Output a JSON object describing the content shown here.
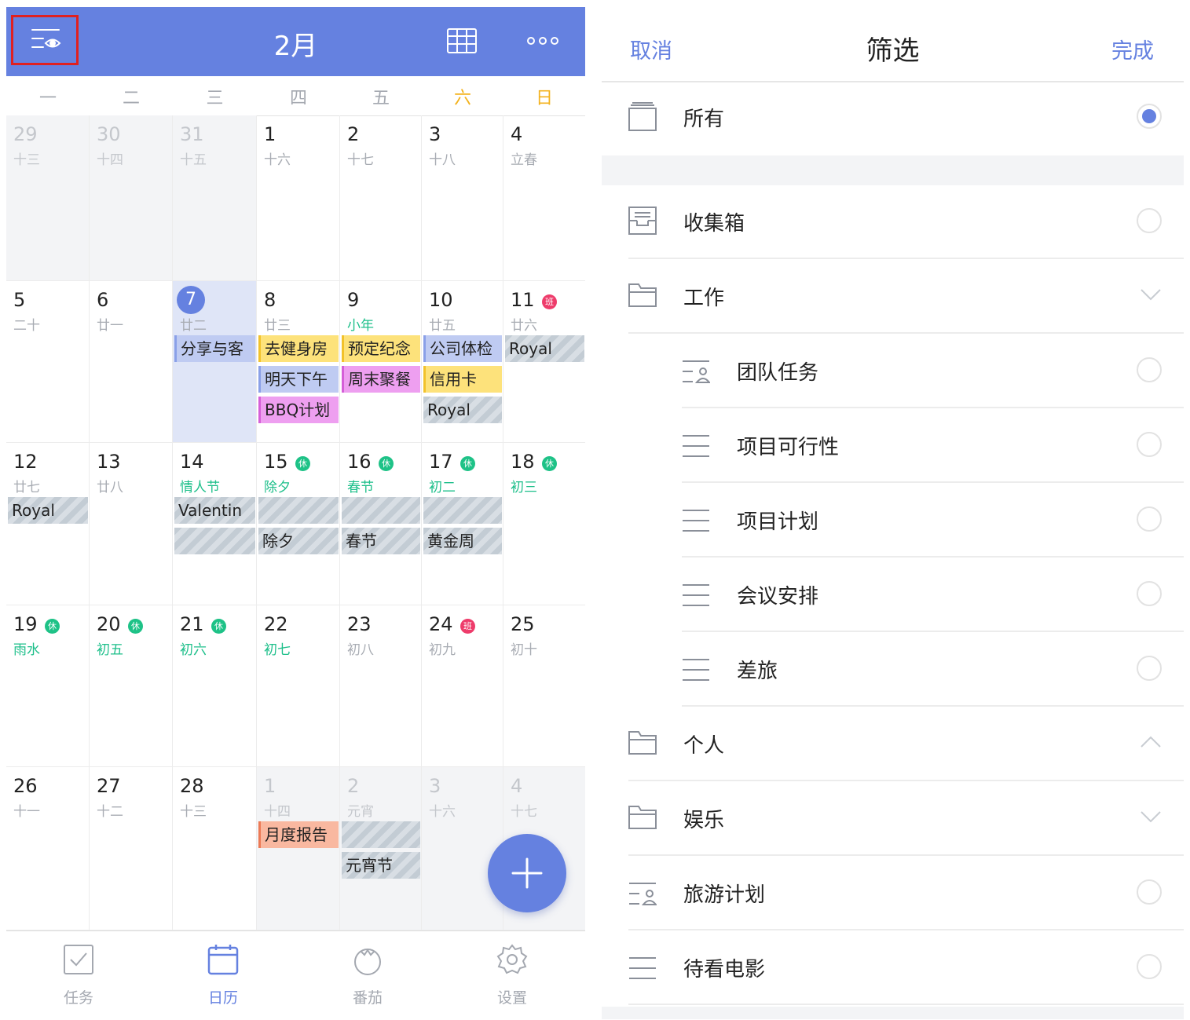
{
  "calendar": {
    "month_title": "2月",
    "weekdays": [
      {
        "label": "一",
        "weekend": false
      },
      {
        "label": "二",
        "weekend": false
      },
      {
        "label": "三",
        "weekend": false
      },
      {
        "label": "四",
        "weekend": false
      },
      {
        "label": "五",
        "weekend": false
      },
      {
        "label": "六",
        "weekend": true
      },
      {
        "label": "日",
        "weekend": true
      }
    ],
    "weeks": [
      [
        {
          "day": "29",
          "lunar": "十三",
          "out": true
        },
        {
          "day": "30",
          "lunar": "十四",
          "out": true
        },
        {
          "day": "31",
          "lunar": "十五",
          "out": true
        },
        {
          "day": "1",
          "lunar": "十六"
        },
        {
          "day": "2",
          "lunar": "十七"
        },
        {
          "day": "3",
          "lunar": "十八"
        },
        {
          "day": "4",
          "lunar": "立春"
        }
      ],
      [
        {
          "day": "5",
          "lunar": "二十"
        },
        {
          "day": "6",
          "lunar": "廿一"
        },
        {
          "day": "7",
          "lunar": "廿二",
          "today": true,
          "events": [
            {
              "label": "分享与客",
              "style": "blue"
            }
          ]
        },
        {
          "day": "8",
          "lunar": "廿三",
          "events": [
            {
              "label": "去健身房",
              "style": "yellow"
            },
            {
              "label": "明天下午",
              "style": "blue"
            },
            {
              "label": "BBQ计划",
              "style": "pink"
            }
          ]
        },
        {
          "day": "9",
          "lunar": "小年",
          "lunar_fest": true,
          "events": [
            {
              "label": "预定纪念",
              "style": "yellow"
            },
            {
              "label": "周末聚餐",
              "style": "pink"
            }
          ]
        },
        {
          "day": "10",
          "lunar": "廿五",
          "events": [
            {
              "label": "公司体检",
              "style": "blue"
            },
            {
              "label": "信用卡",
              "style": "yellow"
            },
            {
              "label": "Royal",
              "style": "hatch"
            }
          ]
        },
        {
          "day": "11",
          "lunar": "廿六",
          "badge": "班",
          "badge_type": "work",
          "events": [
            {
              "label": "Royal",
              "style": "hatch"
            }
          ]
        }
      ],
      [
        {
          "day": "12",
          "lunar": "廿七",
          "events": [
            {
              "label": "Royal",
              "style": "hatch"
            }
          ]
        },
        {
          "day": "13",
          "lunar": "廿八"
        },
        {
          "day": "14",
          "lunar": "情人节",
          "lunar_fest": true,
          "events": [
            {
              "label": "Valentin",
              "style": "hatch"
            },
            {
              "label": "",
              "style": "hatch"
            }
          ]
        },
        {
          "day": "15",
          "lunar": "除夕",
          "lunar_fest": true,
          "badge": "休",
          "badge_type": "rest",
          "events": [
            {
              "label": "",
              "style": "hatch"
            },
            {
              "label": "除夕",
              "style": "hatch"
            }
          ]
        },
        {
          "day": "16",
          "lunar": "春节",
          "lunar_fest": true,
          "badge": "休",
          "badge_type": "rest",
          "events": [
            {
              "label": "",
              "style": "hatch"
            },
            {
              "label": "春节",
              "style": "hatch"
            }
          ]
        },
        {
          "day": "17",
          "lunar": "初二",
          "lunar_fest": true,
          "badge": "休",
          "badge_type": "rest",
          "events": [
            {
              "label": "",
              "style": "hatch"
            },
            {
              "label": "黄金周",
              "style": "hatch"
            }
          ]
        },
        {
          "day": "18",
          "lunar": "初三",
          "lunar_fest": true,
          "badge": "休",
          "badge_type": "rest"
        }
      ],
      [
        {
          "day": "19",
          "lunar": "雨水",
          "lunar_fest": true,
          "badge": "休",
          "badge_type": "rest"
        },
        {
          "day": "20",
          "lunar": "初五",
          "lunar_fest": true,
          "badge": "休",
          "badge_type": "rest"
        },
        {
          "day": "21",
          "lunar": "初六",
          "lunar_fest": true,
          "badge": "休",
          "badge_type": "rest"
        },
        {
          "day": "22",
          "lunar": "初七",
          "lunar_fest": true
        },
        {
          "day": "23",
          "lunar": "初八"
        },
        {
          "day": "24",
          "lunar": "初九",
          "badge": "班",
          "badge_type": "work"
        },
        {
          "day": "25",
          "lunar": "初十"
        }
      ],
      [
        {
          "day": "26",
          "lunar": "十一"
        },
        {
          "day": "27",
          "lunar": "十二"
        },
        {
          "day": "28",
          "lunar": "十三"
        },
        {
          "day": "1",
          "lunar": "十四",
          "out": true,
          "events": [
            {
              "label": "月度报告",
              "style": "salmon"
            }
          ]
        },
        {
          "day": "2",
          "lunar": "元宵",
          "lunar_fest": true,
          "out": true,
          "events": [
            {
              "label": "",
              "style": "hatch"
            },
            {
              "label": "元宵节",
              "style": "hatch"
            }
          ]
        },
        {
          "day": "3",
          "lunar": "十六",
          "out": true
        },
        {
          "day": "4",
          "lunar": "十七",
          "out": true
        }
      ]
    ],
    "tabs": [
      {
        "label": "任务",
        "icon": "task-check-icon"
      },
      {
        "label": "日历",
        "icon": "calendar-icon",
        "active": true
      },
      {
        "label": "番茄",
        "icon": "tomato-icon"
      },
      {
        "label": "设置",
        "icon": "gear-icon"
      }
    ],
    "accent": "#6581e0"
  },
  "filter": {
    "cancel_label": "取消",
    "title": "筛选",
    "done_label": "完成",
    "rows": [
      {
        "label": "所有",
        "icon": "stack-icon",
        "control": "radio",
        "checked": true
      },
      {
        "label": "收集箱",
        "icon": "inbox-icon",
        "control": "radio"
      },
      {
        "label": "工作",
        "icon": "folder-icon",
        "control": "chevron-down"
      },
      {
        "label": "团队任务",
        "icon": "team-list-icon",
        "control": "radio",
        "sub": true
      },
      {
        "label": "项目可行性",
        "icon": "list-icon",
        "control": "radio",
        "sub": true
      },
      {
        "label": "项目计划",
        "icon": "list-icon",
        "control": "radio",
        "sub": true
      },
      {
        "label": "会议安排",
        "icon": "list-icon",
        "control": "radio",
        "sub": true
      },
      {
        "label": "差旅",
        "icon": "list-icon",
        "control": "radio",
        "sub": true
      },
      {
        "label": "个人",
        "icon": "folder-icon",
        "control": "chevron-up"
      },
      {
        "label": "娱乐",
        "icon": "folder-icon",
        "control": "chevron-down"
      },
      {
        "label": "旅游计划",
        "icon": "team-list-icon",
        "control": "radio"
      },
      {
        "label": "待看电影",
        "icon": "list-icon",
        "control": "radio"
      }
    ]
  }
}
